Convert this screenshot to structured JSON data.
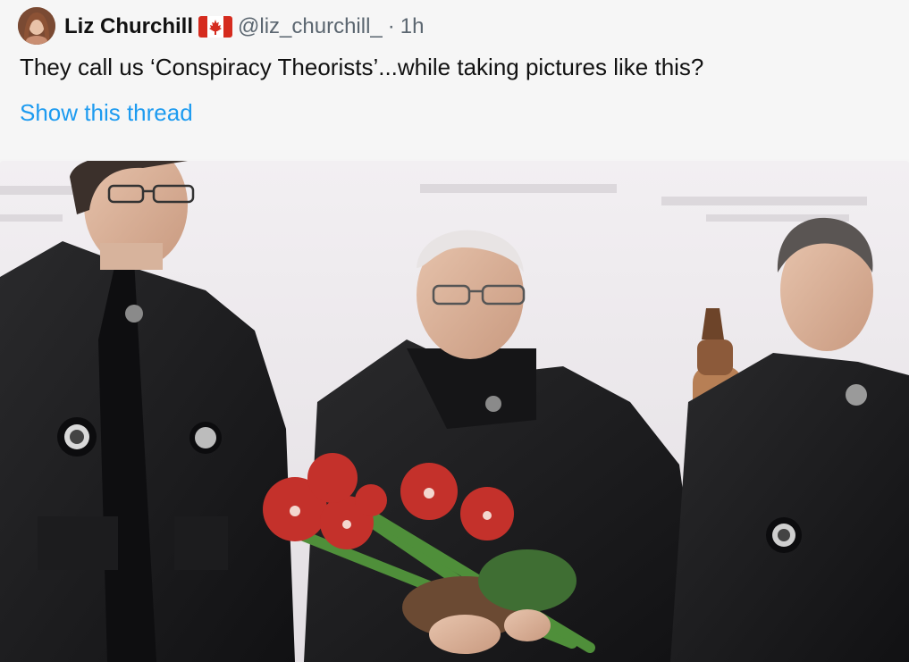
{
  "tweet": {
    "author": {
      "display_name": "Liz Churchill",
      "flag": "canada-flag-icon",
      "handle": "@liz_churchill_",
      "separator": "·",
      "time": "1h"
    },
    "text": "They call us ‘Conspiracy Theorists’...while taking pictures like this?",
    "show_thread_label": "Show this thread",
    "media": {
      "type": "photo",
      "subject": "three-men-in-black-academic-robes-with-bouquet-and-scroll"
    },
    "colors": {
      "link": "#1d9bf0",
      "text": "#111111",
      "muted": "#5b6670",
      "flag_red": "#d52b1e"
    }
  }
}
